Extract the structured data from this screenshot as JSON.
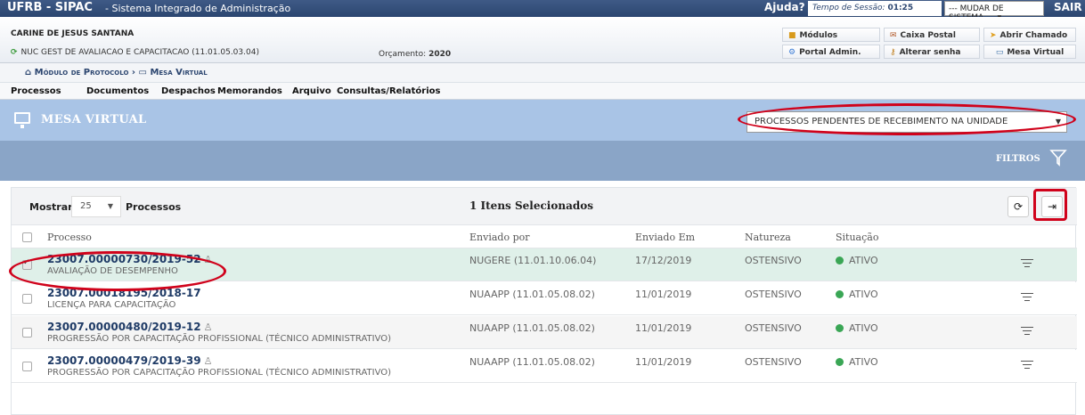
{
  "topbar": {
    "brand": "UFRB - SIPAC",
    "system": "- Sistema Integrado de Administração",
    "help": "Ajuda?",
    "session_label": "Tempo de Sessão:",
    "session_time": "01:25",
    "change_system": "--- MUDAR DE SISTEMA ---",
    "logout": "SAIR"
  },
  "user": {
    "name": "CARINE DE JESUS SANTANA",
    "unit": "NUC GEST DE AVALIACAO E CAPACITACAO (11.01.05.03.04)",
    "budget_label": "Orçamento:",
    "budget_year": "2020"
  },
  "shortcuts": {
    "modules": "Módulos",
    "mailbox": "Caixa Postal",
    "open_ticket": "Abrir Chamado",
    "admin_portal": "Portal Admin.",
    "change_password": "Alterar senha",
    "virtual_desk": "Mesa Virtual"
  },
  "breadcrumb": {
    "module": "Módulo de Protocolo",
    "page": "Mesa Virtual"
  },
  "menu": [
    "Processos",
    "Documentos",
    "Despachos",
    "Memorandos",
    "Arquivo",
    "Consultas/Relatórios"
  ],
  "mesa": {
    "title": "MESA VIRTUAL",
    "view_select": "PROCESSOS PENDENTES DE RECEBIMENTO NA UNIDADE"
  },
  "filters": {
    "label": "FILTROS"
  },
  "toolbar": {
    "show_label": "Mostrar",
    "per_page": "25",
    "items_label": "Processos",
    "selected_count": "1 Itens Selecionados"
  },
  "table": {
    "headers": {
      "process": "Processo",
      "sent_by": "Enviado por",
      "sent_on": "Enviado Em",
      "nature": "Natureza",
      "status": "Situação"
    },
    "rows": [
      {
        "number": "23007.00000730/2019-52",
        "subject": "AVALIAÇÃO DE DESEMPENHO",
        "sent_by": "NUGERE (11.01.10.06.04)",
        "sent_on": "17/12/2019",
        "nature": "OSTENSIVO",
        "status": "ATIVO",
        "checked": true
      },
      {
        "number": "23007.00018195/2018-17",
        "subject": "LICENÇA PARA CAPACITAÇÃO",
        "sent_by": "NUAAPP (11.01.05.08.02)",
        "sent_on": "11/01/2019",
        "nature": "OSTENSIVO",
        "status": "ATIVO",
        "checked": false
      },
      {
        "number": "23007.00000480/2019-12",
        "subject": "PROGRESSÃO POR CAPACITAÇÃO PROFISSIONAL (TÉCNICO ADMINISTRATIVO)",
        "sent_by": "NUAAPP (11.01.05.08.02)",
        "sent_on": "11/01/2019",
        "nature": "OSTENSIVO",
        "status": "ATIVO",
        "checked": false
      },
      {
        "number": "23007.00000479/2019-39",
        "subject": "PROGRESSÃO POR CAPACITAÇÃO PROFISSIONAL (TÉCNICO ADMINISTRATIVO)",
        "sent_by": "NUAAPP (11.01.05.08.02)",
        "sent_on": "11/01/2019",
        "nature": "OSTENSIVO",
        "status": "ATIVO",
        "checked": false
      }
    ]
  },
  "colors": {
    "topbar": "#2c4670",
    "mesa_header": "#a9c4e6",
    "filter_bar": "#8aa5c7",
    "selected_row": "#dff0e9",
    "status_active": "#3aa655",
    "annotation": "#d0021b"
  }
}
